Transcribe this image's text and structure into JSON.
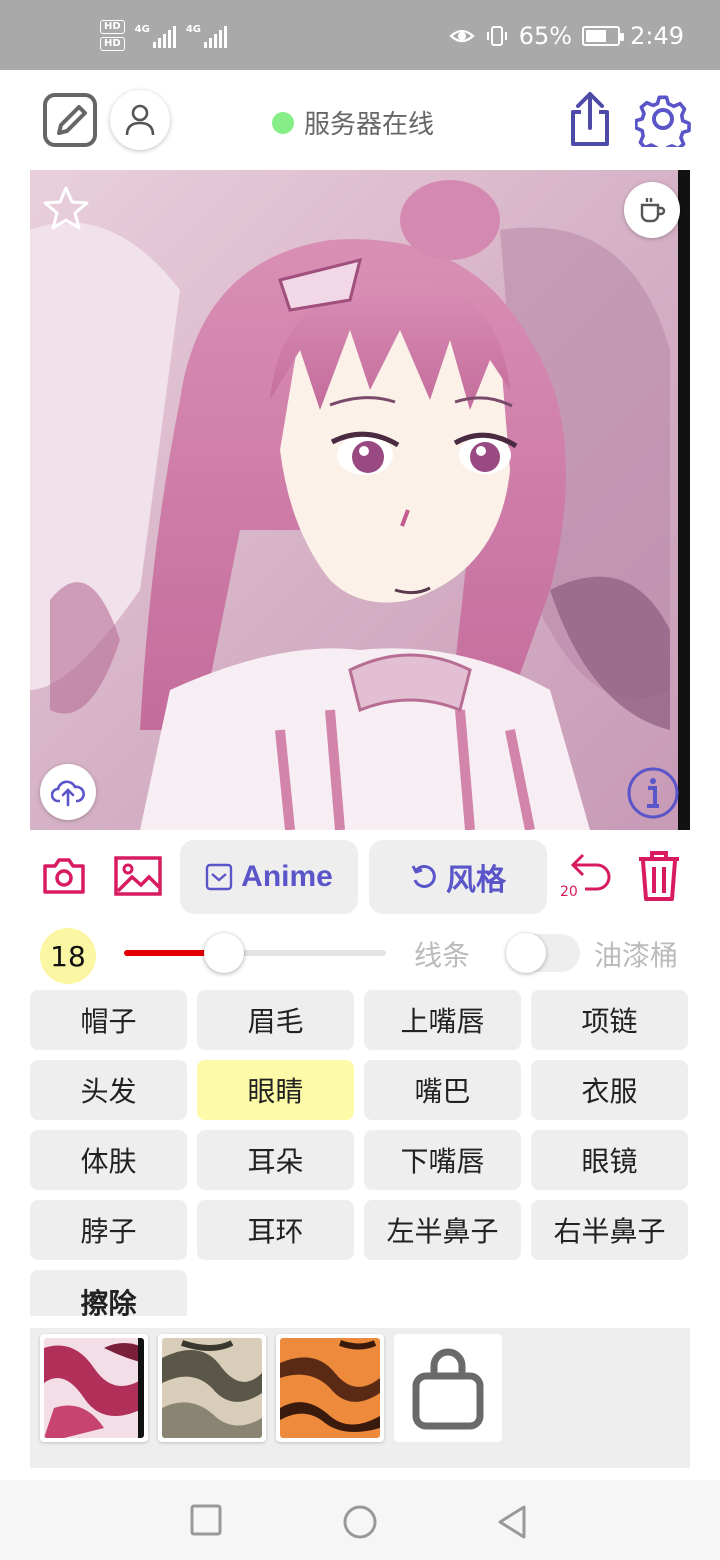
{
  "status_bar": {
    "network_tags": [
      "HD",
      "HD"
    ],
    "signal_labels": [
      "4G",
      "4G"
    ],
    "battery_percent": "65%",
    "battery_level": 0.65,
    "time": "2:49"
  },
  "header": {
    "server_status": "服务器在线",
    "server_status_color": "#86ee86"
  },
  "toolbar": {
    "anime_label": "Anime",
    "style_label": "风格",
    "undo_count": "20",
    "accent_color": "#5a55c8",
    "danger_color": "#d81b60"
  },
  "brush": {
    "size": "18",
    "size_fraction": 0.38,
    "line_label": "线条",
    "bucket_label": "油漆桶",
    "bucket_enabled": false
  },
  "parts": [
    {
      "label": "帽子",
      "selected": false
    },
    {
      "label": "眉毛",
      "selected": false
    },
    {
      "label": "上嘴唇",
      "selected": false
    },
    {
      "label": "项链",
      "selected": false
    },
    {
      "label": "头发",
      "selected": false
    },
    {
      "label": "眼睛",
      "selected": true
    },
    {
      "label": "嘴巴",
      "selected": false
    },
    {
      "label": "衣服",
      "selected": false
    },
    {
      "label": "体肤",
      "selected": false
    },
    {
      "label": "耳朵",
      "selected": false
    },
    {
      "label": "下嘴唇",
      "selected": false
    },
    {
      "label": "眼镜",
      "selected": false
    },
    {
      "label": "脖子",
      "selected": false
    },
    {
      "label": "耳环",
      "selected": false
    },
    {
      "label": "左半鼻子",
      "selected": false
    },
    {
      "label": "右半鼻子",
      "selected": false
    }
  ],
  "erase_label": "擦除",
  "palette": {
    "swatches": [
      "pink-red-texture",
      "beige-gray-texture",
      "orange-tiger-texture"
    ],
    "shop_icon": "shopping-bag-icon"
  }
}
